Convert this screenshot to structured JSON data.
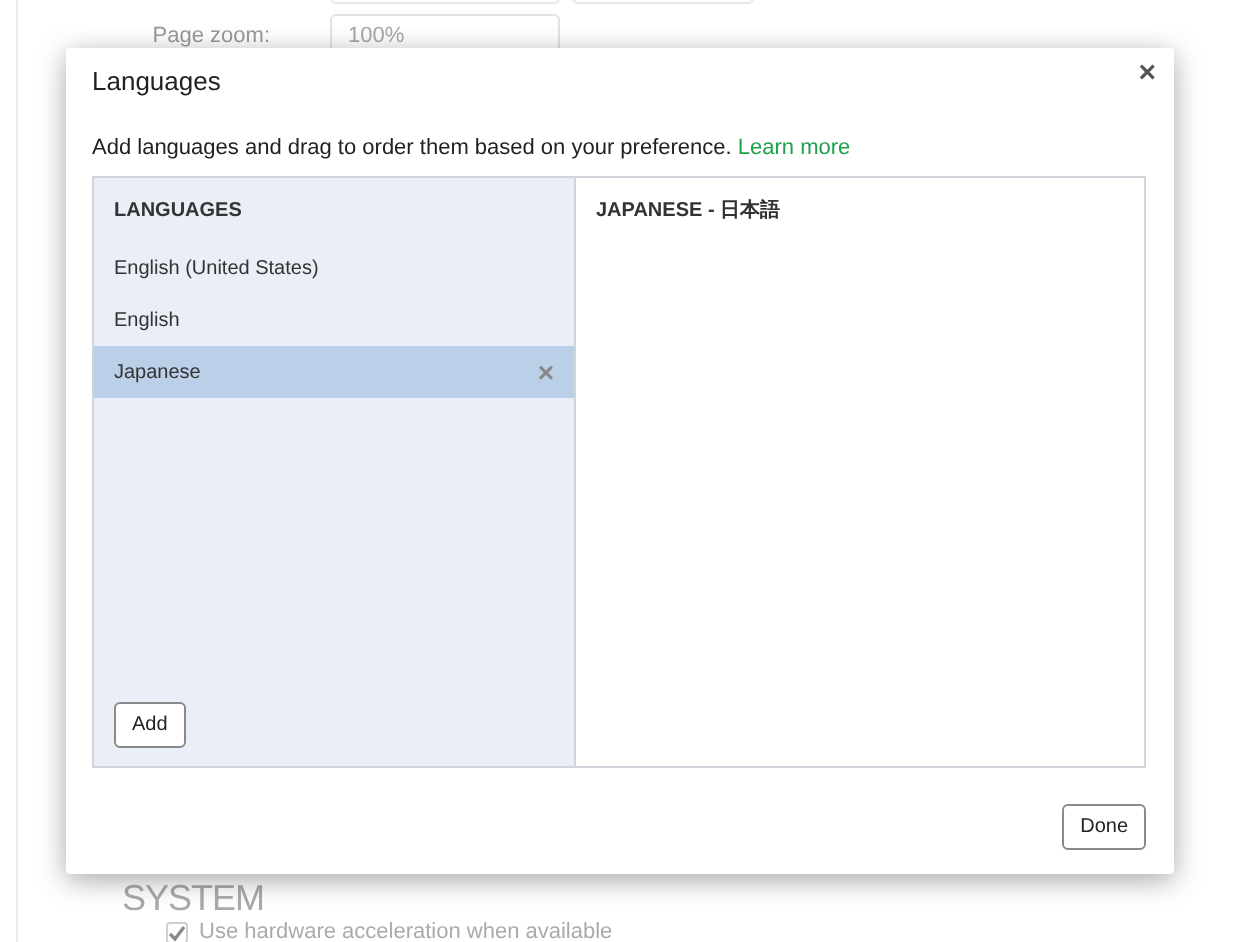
{
  "settings_page": {
    "page_zoom": {
      "label": "Page zoom:",
      "value": "100%"
    },
    "system_heading": "SYSTEM",
    "hardware_acceleration": {
      "label": "Use hardware acceleration when available",
      "checked": true
    }
  },
  "dialog": {
    "title": "Languages",
    "close": "×",
    "description": "Add languages and drag to order them based on your preference.",
    "learn_more": "Learn more",
    "list_heading": "LANGUAGES",
    "languages": [
      {
        "name": "English (United States)",
        "selected": false
      },
      {
        "name": "English",
        "selected": false
      },
      {
        "name": "Japanese",
        "selected": true
      }
    ],
    "remove": "×",
    "add_button": "Add",
    "detail_heading": "JAPANESE - 日本語",
    "done_button": "Done"
  }
}
